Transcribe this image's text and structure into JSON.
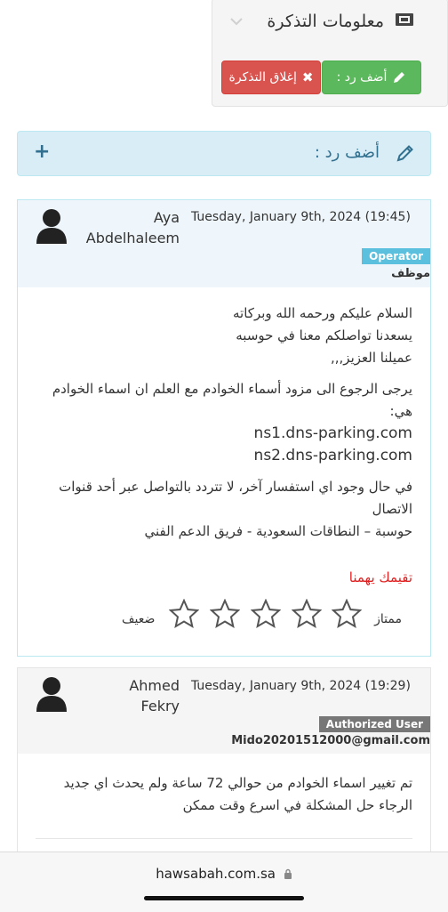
{
  "ticket_info": {
    "title": "معلومات التذكرة",
    "add_reply_btn": "أضف رد :",
    "close_ticket_btn": "إغلاق التذكرة"
  },
  "reply_bar": {
    "label": "أضف رد :",
    "toggle": "+"
  },
  "messages": [
    {
      "author_first": "Aya",
      "author_last": "Abdelhaleem",
      "date": "Tuesday, January 9th, 2024 (19:45)",
      "role_badge": "Operator",
      "role_sub": "موظف",
      "lines": [
        "السلام عليكم ورحمه الله وبركاته",
        "يسعدنا تواصلكم معنا في حوسبه",
        "عميلنا العزيز,,,",
        "يرجى الرجوع الى مزود أسماء الخوادم مع العلم ان اسماء الخوادم",
        "هي:",
        "ns1.dns-parking.com",
        "ns2.dns-parking.com",
        "في حال وجود اي استفسار آخر، لا تتردد بالتواصل عبر أحد قنوات",
        "الاتصال",
        "حوسبة – النطاقات السعودية - فريق الدعم الفني"
      ],
      "rating": {
        "prompt": "تقيمك يهمنا",
        "best": "ممتاز",
        "worst": "ضعيف",
        "stars": 5
      }
    },
    {
      "author_first": "Ahmed",
      "author_last": "Fekry",
      "date": "Tuesday, January 9th, 2024 (19:29)",
      "role_badge": "Authorized User",
      "role_sub": "Mido20201512000@gmail.com",
      "lines": [
        "تم تغيير اسماء الخوادم من حوالي 72 ساعة ولم يحدث اي جديد",
        "الرجاء حل المشكلة في اسرع وقت ممكن"
      ]
    }
  ],
  "browser": {
    "url": "hawsabah.com.sa"
  },
  "colors": {
    "operator": "#5bc0de",
    "authorized": "#777777",
    "success": "#5cb85c",
    "danger": "#d9534f",
    "info_bg": "#d9edf7"
  }
}
